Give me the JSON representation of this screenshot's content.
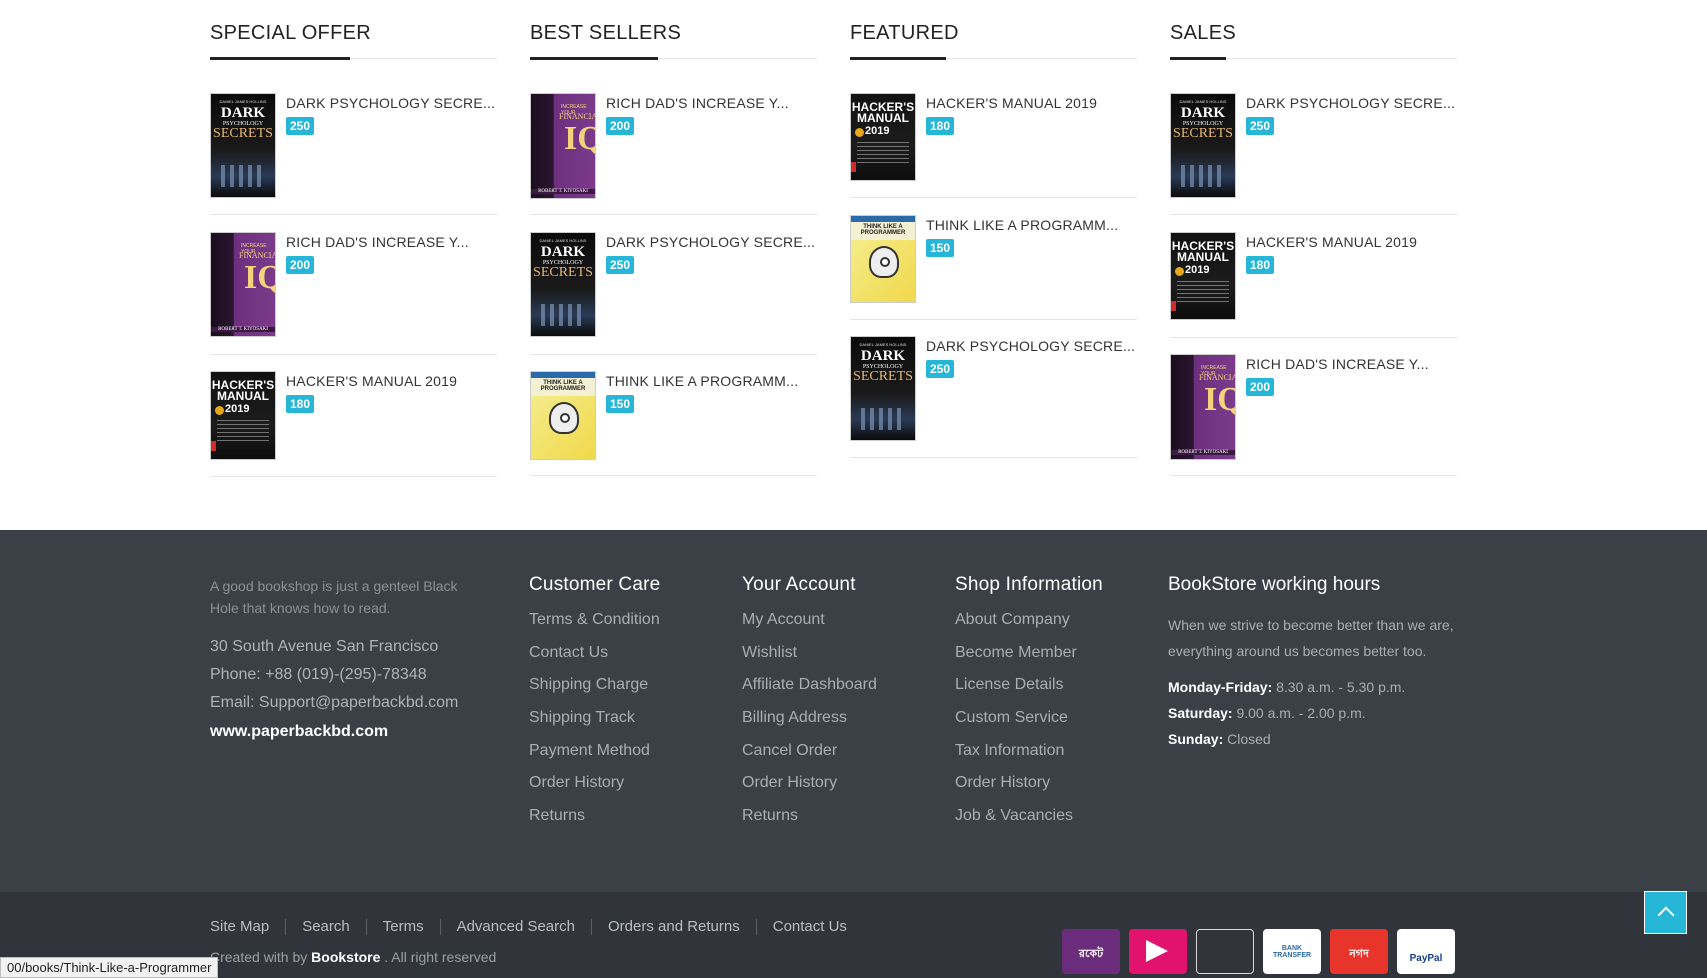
{
  "columns": [
    {
      "title": "SPECIAL OFFER",
      "products": [
        {
          "name": "DARK PSYCHOLOGY SECRE...",
          "price": "250",
          "cover": "dark"
        },
        {
          "name": "RICH DAD'S INCREASE Y...",
          "price": "200",
          "cover": "rich"
        },
        {
          "name": "HACKER'S MANUAL 2019",
          "price": "180",
          "cover": "hack"
        }
      ]
    },
    {
      "title": "BEST SELLERS",
      "products": [
        {
          "name": "RICH DAD'S INCREASE Y...",
          "price": "200",
          "cover": "rich"
        },
        {
          "name": "DARK PSYCHOLOGY SECRE...",
          "price": "250",
          "cover": "dark"
        },
        {
          "name": "THINK LIKE A PROGRAMM...",
          "price": "150",
          "cover": "think"
        }
      ]
    },
    {
      "title": "FEATURED",
      "products": [
        {
          "name": "HACKER'S MANUAL 2019",
          "price": "180",
          "cover": "hack"
        },
        {
          "name": "THINK LIKE A PROGRAMM...",
          "price": "150",
          "cover": "think"
        },
        {
          "name": "DARK PSYCHOLOGY SECRE...",
          "price": "250",
          "cover": "dark"
        }
      ]
    },
    {
      "title": "SALES",
      "products": [
        {
          "name": "DARK PSYCHOLOGY SECRE...",
          "price": "250",
          "cover": "dark"
        },
        {
          "name": "HACKER'S MANUAL 2019",
          "price": "180",
          "cover": "hack"
        },
        {
          "name": "RICH DAD'S INCREASE Y...",
          "price": "200",
          "cover": "rich"
        }
      ]
    }
  ],
  "covers": {
    "dark": {
      "author": "DANIEL JAMES HOLLINS",
      "line1": "DARK",
      "line2": "PSYCHOLOGY",
      "line3": "SECRETS"
    },
    "rich": {
      "line1": "INCREASE YOUR",
      "line2": "FINANCIAL",
      "line3": "IQ",
      "author": "ROBERT T. KIYOSAKI"
    },
    "hack": {
      "line1": "HACKER'S MANUAL",
      "line2": "2019"
    },
    "think": {
      "line1": "THINK LIKE A PROGRAMMER"
    }
  },
  "footer": {
    "tagline": "A good bookshop is just a genteel Black Hole that knows how to read.",
    "address": "30 South Avenue San Francisco",
    "phone": "Phone: +88 (019)-(295)-78348",
    "email": "Email: Support@paperbackbd.com",
    "website": "www.paperbackbd.com",
    "customer_care": {
      "title": "Customer Care",
      "links": [
        "Terms & Condition",
        "Contact Us",
        "Shipping Charge",
        "Shipping Track",
        "Payment Method",
        "Order History",
        "Returns"
      ]
    },
    "your_account": {
      "title": "Your Account",
      "links": [
        "My Account",
        "Wishlist",
        "Affiliate Dashboard",
        "Billing Address",
        "Cancel Order",
        "Order History",
        "Returns"
      ]
    },
    "shop_info": {
      "title": "Shop Information",
      "links": [
        "About Company",
        "Become Member",
        "License Details",
        "Custom Service",
        "Tax Information",
        "Order History",
        "Job & Vacancies"
      ]
    },
    "hours": {
      "title": "BookStore working hours",
      "description": "When we strive to become better than we are, everything around us becomes better too.",
      "rows": [
        {
          "day": "Monday-Friday:",
          "time": " 8.30 a.m. - 5.30 p.m."
        },
        {
          "day": "Saturday:",
          "time": " 9.00 a.m. - 2.00 p.m."
        },
        {
          "day": "Sunday:",
          "time": " Closed"
        }
      ]
    }
  },
  "bottom_nav": [
    "Site Map",
    "Search",
    "Terms",
    "Advanced Search",
    "Orders and Returns",
    "Contact Us"
  ],
  "copyright": {
    "prefix": "Created with by ",
    "brand": "Bookstore",
    "suffix": " . All right reserved"
  },
  "payment_methods": [
    {
      "name": "rocket",
      "label": "রকেট",
      "bg": "#6b2d7b"
    },
    {
      "name": "upay",
      "label": "",
      "bg": "#e2136e"
    },
    {
      "name": "blank",
      "label": "",
      "bg": "#31353b"
    },
    {
      "name": "bank-transfer",
      "label": "BANK TRANSFER",
      "bg": "#ffffff"
    },
    {
      "name": "nagad",
      "label": "নগদ",
      "bg": "#e8352c"
    },
    {
      "name": "paypal",
      "label": "PayPal",
      "bg": "#ffffff"
    }
  ],
  "status_url": "00/books/Think-Like-a-Programmer",
  "colors": {
    "accent": "#26b6d8",
    "footer_bg": "#3b3f46",
    "bottom_bg": "#31353b"
  }
}
